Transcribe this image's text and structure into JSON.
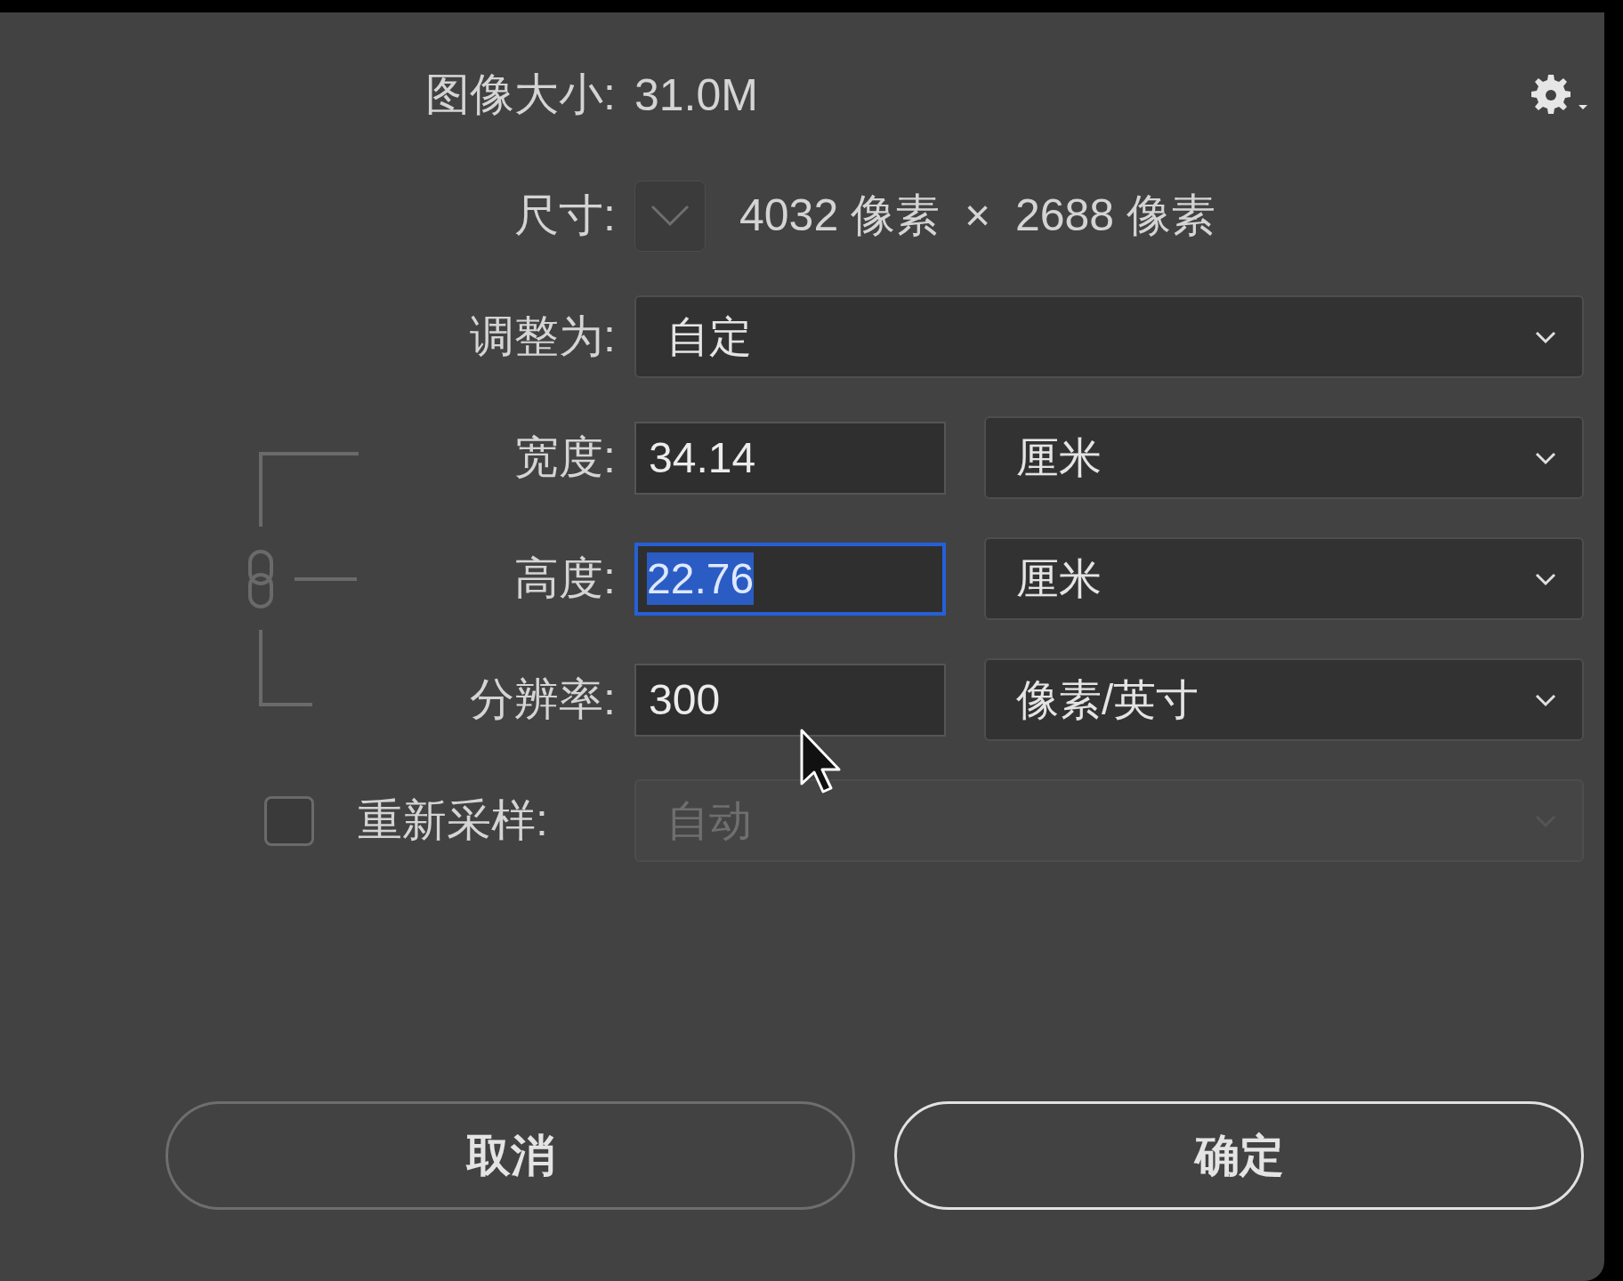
{
  "header": {
    "label": "图像大小:",
    "value": "31.0M"
  },
  "dimensions": {
    "label": "尺寸:",
    "value": "4032 像素  ×  2688 像素"
  },
  "fit_to": {
    "label": "调整为:",
    "value": "自定"
  },
  "fields": [
    {
      "label": "宽度:",
      "value": "34.14",
      "unit": "厘米",
      "selected": false
    },
    {
      "label": "高度:",
      "value": "22.76",
      "unit": "厘米",
      "selected": true
    },
    {
      "label": "分辨率:",
      "value": "300",
      "unit": "像素/英寸",
      "selected": false
    }
  ],
  "resample": {
    "label": "重新采样:",
    "checked": false,
    "value": "自动",
    "disabled": true
  },
  "buttons": [
    {
      "label": "取消",
      "default": false
    },
    {
      "label": "确定",
      "default": true
    }
  ]
}
